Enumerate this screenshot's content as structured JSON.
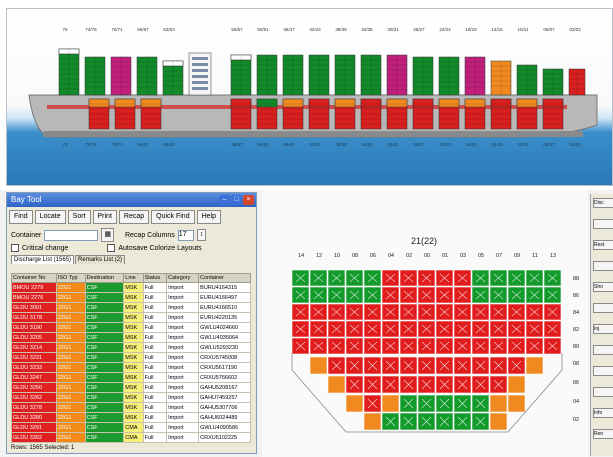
{
  "ship_panel": {
    "bay_numbers_top": [
      "76",
      "74/75",
      "70/71",
      "66/67",
      "62/63",
      "56/57",
      "50/51",
      "46/47",
      "42/43",
      "38/39",
      "34/35",
      "30/31",
      "26/27",
      "22/23",
      "18/19",
      "14/15",
      "10/11",
      "06/07",
      "02/03"
    ],
    "bay_numbers_bottom": [
      "76",
      "74/75",
      "70/71",
      "66/67",
      "62/63",
      "56/57",
      "50/51",
      "46/47",
      "42/43",
      "38/39",
      "34/35",
      "30/31",
      "26/27",
      "22/23",
      "18/19",
      "14/15",
      "10/11",
      "06/07",
      "02/03"
    ],
    "colors": {
      "hull": "#b8b8b8",
      "hull_dark": "#8a8a8a",
      "deck_red": "#d92020",
      "green": "#138a2a",
      "magenta": "#c0207a",
      "orange": "#f08a20",
      "white": "#ffffff",
      "water": "#2a78b6"
    }
  },
  "dialog": {
    "title": "Bay Tool",
    "toolbar": [
      "Find",
      "Locate",
      "Sort",
      "Print",
      "Recap",
      "Quick Find",
      "Help"
    ],
    "container_label": "Container",
    "container_value": "",
    "recap_label": "Recap Columns",
    "recap_value": "17",
    "critical_change_label": "Critical change",
    "autosave_label": "Autosave Colorize Layouts",
    "tabs": [
      "Discharge List (1565)",
      "Remarks List (2)"
    ],
    "columns": [
      "Container No",
      "ISO Typ",
      "Destination",
      "Line",
      "Status",
      "Category",
      "Container"
    ],
    "rows": [
      [
        "BMOU 2279",
        "22G1",
        "CSF",
        "MSK",
        "Full",
        "Import",
        "BURU4164315"
      ],
      [
        "BMOU 2276",
        "22G1",
        "CSF",
        "MSK",
        "Full",
        "Import",
        "EURU4166497"
      ],
      [
        "GLDU 3001",
        "22G1",
        "CSF",
        "MSK",
        "Full",
        "Import",
        "EURU4166510"
      ],
      [
        "GLDU 3178",
        "22G1",
        "CSF",
        "MSK",
        "Full",
        "Import",
        "EURU4220135"
      ],
      [
        "GLDU 3190",
        "22G1",
        "CSF",
        "MSK",
        "Full",
        "Import",
        "GWLU4024660"
      ],
      [
        "GLDU 3205",
        "22G1",
        "CSF",
        "MSK",
        "Full",
        "Import",
        "GWLU4035064"
      ],
      [
        "GLDU 3214",
        "22G1",
        "CSF",
        "MSK",
        "Full",
        "Import",
        "GWLU5293230"
      ],
      [
        "GLDU 3231",
        "22G1",
        "CSF",
        "MSK",
        "Full",
        "Import",
        "CRXU5745008"
      ],
      [
        "GLDU 3233",
        "22G1",
        "CSF",
        "MSK",
        "Full",
        "Import",
        "CRXU5617190"
      ],
      [
        "GLDU 3247",
        "22G1",
        "CSF",
        "MSK",
        "Full",
        "Import",
        "CRXU5766602"
      ],
      [
        "GLDU 3250",
        "22G1",
        "CSF",
        "MSK",
        "Full",
        "Import",
        "GAHU5208167"
      ],
      [
        "GLDU 3262",
        "22G1",
        "CSF",
        "MSK",
        "Full",
        "Import",
        "GAHU7459257"
      ],
      [
        "GLDU 3278",
        "22G1",
        "CSF",
        "MSK",
        "Full",
        "Import",
        "GAHU5307706"
      ],
      [
        "GLDU 3280",
        "22G1",
        "CSF",
        "MSK",
        "Full",
        "Import",
        "GAHU6024489"
      ],
      [
        "GLDU 3291",
        "22G1",
        "CSF",
        "CMA",
        "Full",
        "Import",
        "GWLU4090586"
      ],
      [
        "GLDU 3302",
        "22G1",
        "CSF",
        "CMA",
        "Full",
        "Import",
        "CRXU5102225"
      ]
    ],
    "status_bar": "Rows: 1565   Selected: 1"
  },
  "bay_view": {
    "bay_title": "21(22)",
    "col_labels": [
      "14",
      "12",
      "10",
      "08",
      "06",
      "04",
      "02",
      "00",
      "01",
      "03",
      "05",
      "07",
      "09",
      "11",
      "13"
    ],
    "tier_labels": [
      "88",
      "86",
      "84",
      "82",
      "80",
      "08",
      "06",
      "04",
      "02"
    ],
    "colors": {
      "green": "#129a2a",
      "red": "#e01c1c",
      "orange": "#f08a20",
      "grid": "#c8c8c8"
    }
  },
  "right_strip": {
    "items": [
      "Disc",
      "",
      "Rest",
      "",
      "Sho",
      "",
      "Inj",
      "",
      "",
      "",
      "Info",
      "Ren"
    ]
  }
}
